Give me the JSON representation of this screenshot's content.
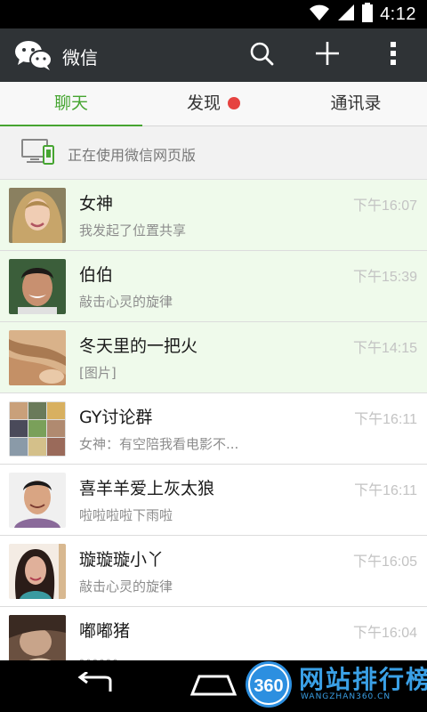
{
  "status_bar": {
    "time": "4:12"
  },
  "action_bar": {
    "title": "微信"
  },
  "tabs": [
    {
      "label": "聊天",
      "active": true
    },
    {
      "label": "发现",
      "badge": true
    },
    {
      "label": "通讯录"
    }
  ],
  "web_banner": {
    "text": "正在使用微信网页版"
  },
  "chats": [
    {
      "name": "女神",
      "time": "下午16:07",
      "preview": "我发起了位置共享",
      "pinned": true
    },
    {
      "name": "伯伯",
      "time": "下午15:39",
      "preview": "敲击心灵的旋律",
      "pinned": true
    },
    {
      "name": "冬天里的一把火",
      "time": "下午14:15",
      "preview": "[图片]",
      "pinned": true
    },
    {
      "name": "GY讨论群",
      "time": "下午16:11",
      "preview": "女神：有空陪我看电影不...",
      "pinned": false
    },
    {
      "name": "喜羊羊爱上灰太狼",
      "time": "下午16:11",
      "preview": "啦啦啦啦下雨啦",
      "pinned": false
    },
    {
      "name": "璇璇璇小丫",
      "time": "下午16:05",
      "preview": "敲击心灵的旋律",
      "pinned": false
    },
    {
      "name": "嘟嘟猪",
      "time": "下午16:04",
      "preview": "。。。。。。",
      "pinned": false
    }
  ],
  "watermark": {
    "badge": "360",
    "text": "网站排行榜",
    "sub": "WANGZHAN360.CN"
  },
  "colors": {
    "accent": "#46a531",
    "action_bar": "#2f3336",
    "pinned_bg": "#effaeb",
    "badge_red": "#e64340"
  }
}
